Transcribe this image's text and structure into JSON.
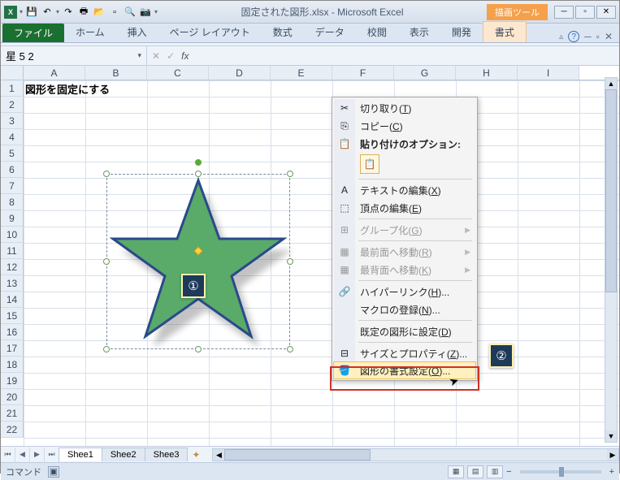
{
  "title": "固定された図形.xlsx - Microsoft Excel",
  "contextual_tab_group": "描画ツール",
  "ribbon": {
    "file": "ファイル",
    "tabs": [
      "ホーム",
      "挿入",
      "ページ レイアウト",
      "数式",
      "データ",
      "校閲",
      "表示",
      "開発"
    ],
    "contextual": "書式",
    "help_icon": "?"
  },
  "name_box": "星 5 2",
  "fx_label": "fx",
  "columns": [
    "A",
    "B",
    "C",
    "D",
    "E",
    "F",
    "G",
    "H",
    "I"
  ],
  "rows": [
    "1",
    "2",
    "3",
    "4",
    "5",
    "6",
    "7",
    "8",
    "9",
    "10",
    "11",
    "12",
    "13",
    "14",
    "15",
    "16",
    "17",
    "18",
    "19",
    "20",
    "21",
    "22"
  ],
  "cell_a1": "図形を固定にする",
  "context_menu": {
    "cut": {
      "label": "切り取り(",
      "key": "T",
      "tail": ")"
    },
    "copy": {
      "label": "コピー(",
      "key": "C",
      "tail": ")"
    },
    "paste_options": "貼り付けのオプション:",
    "edit_text": {
      "label": "テキストの編集(",
      "key": "X",
      "tail": ")"
    },
    "edit_points": {
      "label": "頂点の編集(",
      "key": "E",
      "tail": ")"
    },
    "group": {
      "label": "グループ化(",
      "key": "G",
      "tail": ")"
    },
    "bring_front": {
      "label": "最前面へ移動(",
      "key": "R",
      "tail": ")"
    },
    "send_back": {
      "label": "最背面へ移動(",
      "key": "K",
      "tail": ")"
    },
    "hyperlink": {
      "label": "ハイパーリンク(",
      "key": "H",
      "tail": ")..."
    },
    "macro": {
      "label": "マクロの登録(",
      "key": "N",
      "tail": ")..."
    },
    "set_default": {
      "label": "既定の図形に設定(",
      "key": "D",
      "tail": ")"
    },
    "size_props": {
      "label": "サイズとプロパティ(",
      "key": "Z",
      "tail": ")..."
    },
    "format_shape": {
      "label": "図形の書式設定(",
      "key": "O",
      "tail": ")..."
    }
  },
  "badges": {
    "one": "①",
    "two": "②"
  },
  "sheets": [
    "Shee1",
    "Shee2",
    "Shee3"
  ],
  "status": "コマンド",
  "zoom": {
    "minus": "−",
    "plus": "+"
  }
}
